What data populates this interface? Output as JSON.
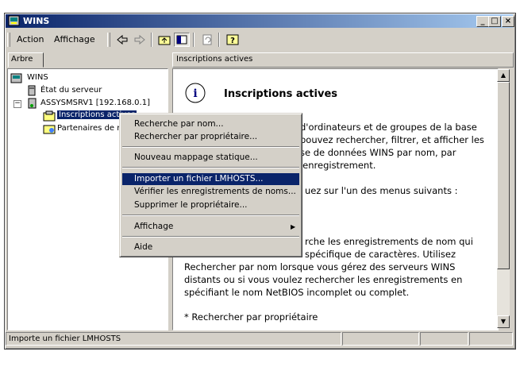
{
  "window": {
    "title": "WINS"
  },
  "caption_buttons": [
    "_",
    "□",
    "×"
  ],
  "menu": {
    "action": "Action",
    "view": "Affichage"
  },
  "panes": {
    "left_tab": "Arbre",
    "right_header": "Inscriptions actives"
  },
  "tree": {
    "root": "WINS",
    "server_status": "État du serveur",
    "server": "ASSYSMSRV1 [192.168.0.1]",
    "active_registrations": "Inscriptions actives",
    "partners": "Partenaires de r"
  },
  "content": {
    "heading": "Inscriptions actives",
    "lines": [
      "d'ordinateurs et de groupes de la base",
      "pouvez rechercher, filtrer, et afficher les",
      "se de données WINS par nom, par",
      "'enregistrement.",
      "uez sur l'un des menus suivants :",
      "rche les enregistrements de nom qui",
      "spécifique de caractères. Utilisez",
      "Rechercher par nom lorsque vous gérez des serveurs WINS",
      "distants ou si vous voulez rechercher les enregistrements en",
      "spécifiant le nom NetBIOS incomplet ou complet.",
      "*  Rechercher par propriétaire"
    ]
  },
  "context_menu": {
    "items": [
      "Recherche par nom...",
      "Rechercher par propriétaire...",
      "Nouveau mappage statique...",
      "Importer un fichier LMHOSTS...",
      "Vérifier les enregistrements de noms...",
      "Supprimer le propriétaire...",
      "Affichage",
      "Aide"
    ],
    "selected_index": 3
  },
  "statusbar": {
    "text": "Importe un fichier LMHOSTS"
  },
  "colors": {
    "title_start": "#0a246a",
    "title_end": "#a6caf0",
    "face": "#d4d0c8",
    "highlight": "#0a246a"
  }
}
